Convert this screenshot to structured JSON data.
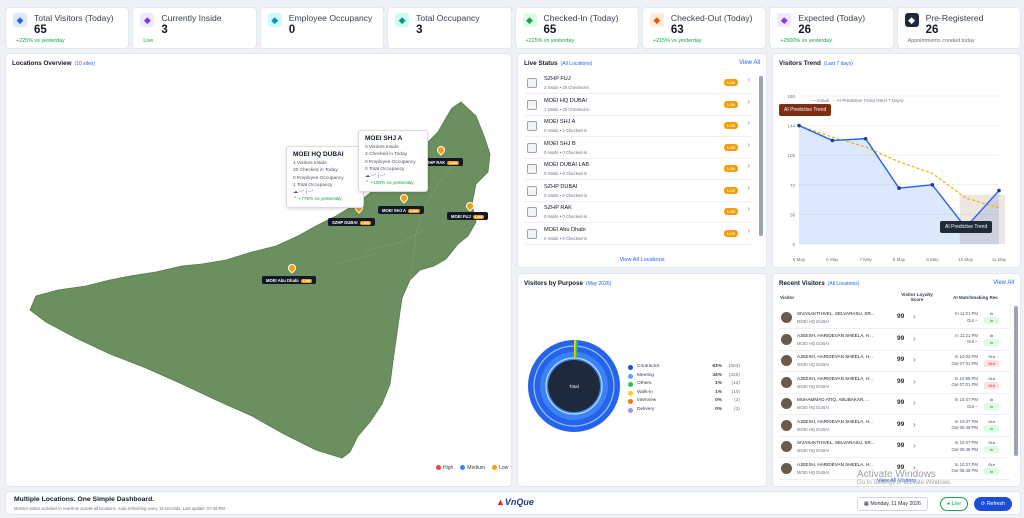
{
  "kpis": [
    {
      "label": "Total Visitors (Today)",
      "value": "65",
      "sub": "+225% vs yesterday",
      "icon": "users-icon",
      "color": "#dbeafe",
      "fg": "#2563eb",
      "subtone": "green"
    },
    {
      "label": "Currently Inside",
      "value": "3",
      "sub": "Live",
      "icon": "door-icon",
      "color": "#ede9fe",
      "fg": "#7c3aed",
      "subtone": "green"
    },
    {
      "label": "Employee Occupancy",
      "value": "0",
      "sub": "",
      "icon": "employee-icon",
      "color": "#cffafe",
      "fg": "#0891b2",
      "subtone": "green"
    },
    {
      "label": "Total Occupancy",
      "value": "3",
      "sub": "",
      "icon": "building-icon",
      "color": "#ccfbf1",
      "fg": "#0d9488",
      "subtone": "green"
    },
    {
      "label": "Checked-In (Today)",
      "value": "65",
      "sub": "+225% vs yesterday",
      "icon": "checkin-icon",
      "color": "#dcfce7",
      "fg": "#16a34a",
      "subtone": "green"
    },
    {
      "label": "Checked-Out (Today)",
      "value": "63",
      "sub": "+215% vs yesterday",
      "icon": "checkout-icon",
      "color": "#ffedd5",
      "fg": "#ea580c",
      "subtone": "green"
    },
    {
      "label": "Expected (Today)",
      "value": "26",
      "sub": "+2500% vs yesterday",
      "icon": "calendar-icon",
      "color": "#f3e8ff",
      "fg": "#9333ea",
      "subtone": "green"
    },
    {
      "label": "Pre-Registered",
      "value": "26",
      "sub": "Appointments created today",
      "icon": "id-card-icon",
      "color": "#1f2937",
      "fg": "#ffffff",
      "subtone": "gray"
    }
  ],
  "locations": {
    "title": "Locations Overview",
    "count": "(10 sites)",
    "tip1": {
      "title": "MOEI HQ DUBAI",
      "lines": [
        "1 Visitors Inside",
        "20 Checked in Today",
        "0 Employee Occupancy",
        "1 Total Occupancy"
      ],
      "weather": "--° | --°",
      "growth": "+775% vs yesterday"
    },
    "tip2": {
      "title": "MOEI SHJ A",
      "lines": [
        "0 Visitors Inside",
        "2 Checked in Today",
        "0 Employee Occupancy",
        "0 Total Occupancy"
      ],
      "weather": "--° | --°",
      "growth": "+100% vs yesterday"
    },
    "markers": [
      {
        "label": "SZHP DUBAI",
        "badge": "Low"
      },
      {
        "label": "MOEI SHJ A",
        "badge": "Low"
      },
      {
        "label": "MOEI FUJ",
        "badge": "Low"
      },
      {
        "label": "SZHP RAK",
        "badge": "Low"
      },
      {
        "label": "MOEI Abu Dhabi",
        "badge": "Low"
      }
    ],
    "legend": [
      "High",
      "Medium",
      "Low"
    ],
    "legend_colors": [
      "#ef4444",
      "#3b82f6",
      "#f59e0b"
    ]
  },
  "live": {
    "title": "Live Status",
    "scope": "(All Locations)",
    "link": "View All",
    "footer": "View All Locations",
    "rows": [
      {
        "name": "SZHP FUJ",
        "sub": "2 Inside • 28 Checked-in",
        "badge": "Low"
      },
      {
        "name": "MOEI HQ DUBAI",
        "sub": "1 Inside • 20 Checked-in",
        "badge": "Low"
      },
      {
        "name": "MOEI SHJ A",
        "sub": "0 Inside • 2 Checked-in",
        "badge": "Low"
      },
      {
        "name": "MOEI SHJ B",
        "sub": "0 Inside • 0 Checked-in",
        "badge": "Low"
      },
      {
        "name": "MOEI DUBAI LAB",
        "sub": "0 Inside • 0 Checked-in",
        "badge": "Low"
      },
      {
        "name": "SZHP DUBAI",
        "sub": "0 Inside • 0 Checked-in",
        "badge": "Low"
      },
      {
        "name": "SZHP RAK",
        "sub": "0 Inside • 0 Checked-in",
        "badge": "Low"
      },
      {
        "name": "MOEI Abu Dhabi",
        "sub": "0 Inside • 0 Checked-in",
        "badge": "Low"
      }
    ]
  },
  "trend": {
    "title": "Visitors Trend",
    "scope": "(Last 7 days)",
    "legend_actual": "Actual",
    "legend_pred": "AI Predictive Trend (Next 7 Days)",
    "label_top": "AI Predictive Trend",
    "label_bottom": "AI Predictive Trend"
  },
  "chart_data": {
    "type": "line",
    "x": [
      "5 May",
      "6 May",
      "7 May",
      "8 May",
      "9 May",
      "10 May",
      "11 May"
    ],
    "ylim": [
      0,
      180
    ],
    "yticks": [
      0,
      36,
      72,
      108,
      144,
      180
    ],
    "series": [
      {
        "name": "Actual",
        "values": [
          144,
          126,
          128,
          68,
          72,
          20,
          65
        ]
      },
      {
        "name": "AI Predictive Trend (Next 7 Days)",
        "values": [
          144,
          130,
          118,
          100,
          86,
          56,
          44
        ]
      }
    ]
  },
  "purpose": {
    "title": "Visitors by Purpose",
    "scope": "(May 2026)",
    "center": "Total",
    "items": [
      {
        "name": "Contractor",
        "pct": "63%",
        "count": "(503)",
        "color": "#1d4ed8"
      },
      {
        "name": "Meeting",
        "pct": "34%",
        "count": "(328)",
        "color": "#60a5fa"
      },
      {
        "name": "Others",
        "pct": "1%",
        "count": "(12)",
        "color": "#22c55e"
      },
      {
        "name": "Walk-in",
        "pct": "1%",
        "count": "(10)",
        "color": "#facc15"
      },
      {
        "name": "Interview",
        "pct": "0%",
        "count": "(2)",
        "color": "#f97316"
      },
      {
        "name": "Delivery",
        "pct": "0%",
        "count": "(2)",
        "color": "#a78bfa"
      }
    ]
  },
  "recent": {
    "title": "Recent Visitors",
    "scope": "(All Locations)",
    "link": "View All",
    "cols": [
      "Visitor",
      "Visitor Loyalty Score",
      "AI Matchmaking Rec"
    ],
    "footer": "View All Visitors",
    "rows": [
      {
        "name": "SIVASAKTHIVEL, SELVARASU, SR...",
        "loc": "MOEI HQ DUBAI",
        "score": "99",
        "t1": "In 11:21 PM",
        "t2": "Out --",
        "s1": "In",
        "s2": "In",
        "tone": "in"
      },
      {
        "name": "AJEESH, HARIDEVAN SHEELA, H...",
        "loc": "MOEI HQ DUBAI",
        "score": "99",
        "t1": "In 11:21 PM",
        "t2": "Out --",
        "s1": "In",
        "s2": "In",
        "tone": "in"
      },
      {
        "name": "AJEESH, HARIDEVAN SHEELA, H...",
        "loc": "MOEI HQ DUBAI",
        "score": "99",
        "t1": "In 10:02 PM",
        "t2": "Out 07:01 PM",
        "s1": "Out",
        "s2": "Out",
        "tone": "out"
      },
      {
        "name": "AJEESH, HARIDEVAN SHEELA, H...",
        "loc": "MOEI HQ DUBAI",
        "score": "99",
        "t1": "In 10:58 PM",
        "t2": "Out 07:01 PM",
        "s1": "Out",
        "s2": "Out",
        "tone": "out"
      },
      {
        "name": "MUHAMMAD ATIQ, ABUBAKAR, ...",
        "loc": "MOEI HQ DUBAI",
        "score": "99",
        "t1": "In 10:47 PM",
        "t2": "Out --",
        "s1": "In",
        "s2": "In",
        "tone": "in"
      },
      {
        "name": "AJEESH, HARIDEVAN SHEELA, H...",
        "loc": "MOEI HQ DUBAI",
        "score": "99",
        "t1": "In 10:37 PM",
        "t2": "Out 06:48 PM",
        "s1": "Out",
        "s2": "In",
        "tone": "in"
      },
      {
        "name": "SIVASAKTHIVEL, SELVARASU, SR...",
        "loc": "MOEI HQ DUBAI",
        "score": "99",
        "t1": "In 10:37 PM",
        "t2": "Out 06:48 PM",
        "s1": "Out",
        "s2": "In",
        "tone": "in"
      },
      {
        "name": "AJEESH, HARIDEVAN SHEELA, H...",
        "loc": "MOEI HQ DUBAI",
        "score": "99",
        "t1": "In 10:27 PM",
        "t2": "Out 06:48 PM",
        "s1": "Out",
        "s2": "In",
        "tone": "in"
      }
    ]
  },
  "footer": {
    "title": "Multiple Locations. One Simple Dashboard.",
    "sub": "Monitor visitor activities in real-time across all locations. Auto-refreshing every 15 seconds. Last update: 07:49 PM",
    "brand": "VnQue",
    "date": "Monday, 11 May 2026",
    "live": "Live",
    "refresh": "Refresh"
  },
  "watermark": {
    "line1": "Activate Windows",
    "line2": "Go to Settings to activate Windows."
  }
}
